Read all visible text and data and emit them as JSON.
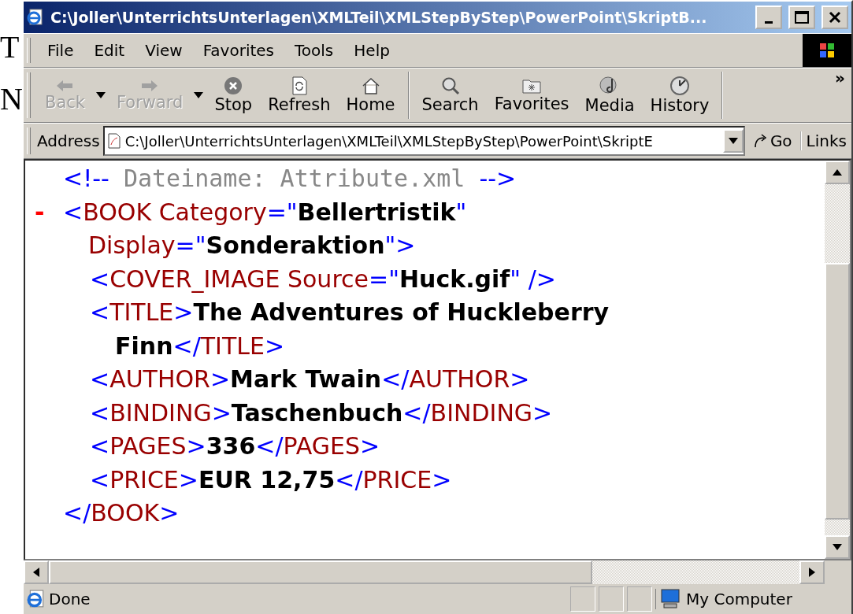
{
  "background_fragments": [
    "T",
    "N"
  ],
  "window": {
    "title": "C:\\Joller\\UnterrichtsUnterlagen\\XMLTeil\\XMLStepByStep\\PowerPoint\\SkriptB..."
  },
  "menu": [
    "File",
    "Edit",
    "View",
    "Favorites",
    "Tools",
    "Help"
  ],
  "toolbar": [
    {
      "label": "Back",
      "disabled": true,
      "dropdown": true
    },
    {
      "label": "Forward",
      "disabled": true,
      "dropdown": true
    },
    {
      "label": "Stop",
      "disabled": false,
      "dropdown": false
    },
    {
      "label": "Refresh",
      "disabled": false,
      "dropdown": false
    },
    {
      "label": "Home",
      "disabled": false,
      "dropdown": false
    },
    {
      "label": "Search",
      "disabled": false,
      "dropdown": false
    },
    {
      "label": "Favorites",
      "disabled": false,
      "dropdown": false
    },
    {
      "label": "Media",
      "disabled": false,
      "dropdown": false
    },
    {
      "label": "History",
      "disabled": false,
      "dropdown": false
    }
  ],
  "toolbar_overflow": "»",
  "address": {
    "label": "Address",
    "value": "C:\\Joller\\UnterrichtsUnterlagen\\XMLTeil\\XMLStepByStep\\PowerPoint\\SkriptE",
    "go": "Go",
    "links": "Links"
  },
  "xml": [
    {
      "tokens": [
        {
          "kind": "mark",
          "text": "<!--"
        },
        {
          "kind": "comment",
          "text": " Dateiname: Attribute.xml "
        },
        {
          "kind": "mark",
          "text": "-->"
        }
      ]
    },
    {
      "toggle": "-",
      "tokens": [
        {
          "kind": "mark",
          "text": "<"
        },
        {
          "kind": "tag",
          "text": "BOOK"
        },
        {
          "kind": "attr",
          "text": " Category"
        },
        {
          "kind": "mark",
          "text": "=\""
        },
        {
          "kind": "value",
          "text": "Bellertristik"
        },
        {
          "kind": "mark",
          "text": "\""
        }
      ],
      "continuation": [
        {
          "kind": "attr",
          "text": "Display"
        },
        {
          "kind": "mark",
          "text": "=\""
        },
        {
          "kind": "value",
          "text": "Sonderaktion"
        },
        {
          "kind": "mark",
          "text": "\">"
        }
      ],
      "children": [
        {
          "tokens": [
            {
              "kind": "mark",
              "text": "<"
            },
            {
              "kind": "tag",
              "text": "COVER_IMAGE"
            },
            {
              "kind": "attr",
              "text": " Source"
            },
            {
              "kind": "mark",
              "text": "=\""
            },
            {
              "kind": "value",
              "text": "Huck.gif"
            },
            {
              "kind": "mark",
              "text": "\" />"
            }
          ]
        },
        {
          "tokens": [
            {
              "kind": "mark",
              "text": "<"
            },
            {
              "kind": "tag",
              "text": "TITLE"
            },
            {
              "kind": "mark",
              "text": ">"
            },
            {
              "kind": "text",
              "text": "The Adventures of Huckleberry"
            }
          ],
          "continuation": [
            {
              "kind": "text",
              "text": "Finn"
            },
            {
              "kind": "mark",
              "text": "</"
            },
            {
              "kind": "tag",
              "text": "TITLE"
            },
            {
              "kind": "mark",
              "text": ">"
            }
          ]
        },
        {
          "tokens": [
            {
              "kind": "mark",
              "text": "<"
            },
            {
              "kind": "tag",
              "text": "AUTHOR"
            },
            {
              "kind": "mark",
              "text": ">"
            },
            {
              "kind": "text",
              "text": "Mark Twain"
            },
            {
              "kind": "mark",
              "text": "</"
            },
            {
              "kind": "tag",
              "text": "AUTHOR"
            },
            {
              "kind": "mark",
              "text": ">"
            }
          ]
        },
        {
          "tokens": [
            {
              "kind": "mark",
              "text": "<"
            },
            {
              "kind": "tag",
              "text": "BINDING"
            },
            {
              "kind": "mark",
              "text": ">"
            },
            {
              "kind": "text",
              "text": "Taschenbuch"
            },
            {
              "kind": "mark",
              "text": "</"
            },
            {
              "kind": "tag",
              "text": "BINDING"
            },
            {
              "kind": "mark",
              "text": ">"
            }
          ]
        },
        {
          "tokens": [
            {
              "kind": "mark",
              "text": "<"
            },
            {
              "kind": "tag",
              "text": "PAGES"
            },
            {
              "kind": "mark",
              "text": ">"
            },
            {
              "kind": "text",
              "text": "336"
            },
            {
              "kind": "mark",
              "text": "</"
            },
            {
              "kind": "tag",
              "text": "PAGES"
            },
            {
              "kind": "mark",
              "text": ">"
            }
          ]
        },
        {
          "tokens": [
            {
              "kind": "mark",
              "text": "<"
            },
            {
              "kind": "tag",
              "text": "PRICE"
            },
            {
              "kind": "mark",
              "text": ">"
            },
            {
              "kind": "text",
              "text": "EUR 12,75"
            },
            {
              "kind": "mark",
              "text": "</"
            },
            {
              "kind": "tag",
              "text": "PRICE"
            },
            {
              "kind": "mark",
              "text": ">"
            }
          ]
        }
      ],
      "end_tokens": [
        {
          "kind": "mark",
          "text": "</"
        },
        {
          "kind": "tag",
          "text": "BOOK"
        },
        {
          "kind": "mark",
          "text": ">"
        }
      ]
    }
  ],
  "status": {
    "text": "Done",
    "zone": "My Computer"
  }
}
